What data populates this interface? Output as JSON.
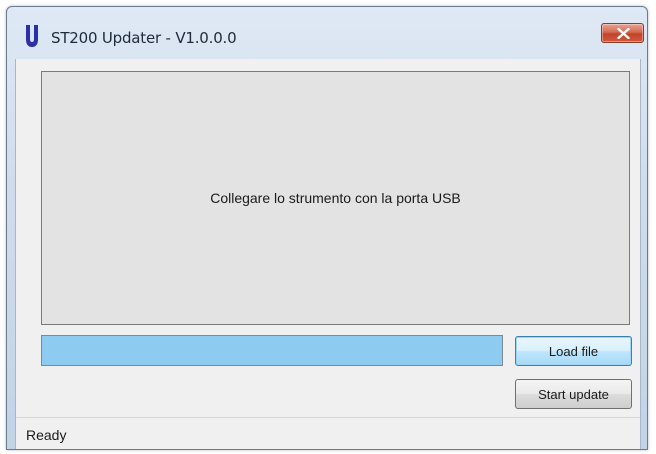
{
  "window": {
    "title": "ST200 Updater - V1.0.0.0",
    "icon": "letter-u-icon",
    "close_icon": "close-icon"
  },
  "main": {
    "message": "Collegare lo strumento con la porta USB"
  },
  "progress": {
    "value_percent": 0
  },
  "buttons": {
    "load_file": "Load file",
    "start_update": "Start update"
  },
  "status": {
    "text": "Ready"
  },
  "colors": {
    "progress_track": "#8ecbf1",
    "app_icon": "#2b2fa8",
    "close_button": "#c2442a"
  }
}
